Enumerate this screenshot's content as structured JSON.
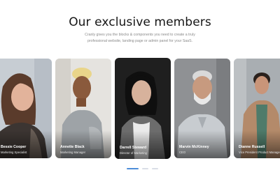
{
  "section": {
    "title": "Our exclusive members",
    "subtitle": "Cranly gives you the blocks & components you need to create a truly professional website, landing page or admin panel for your SaaS."
  },
  "members": [
    {
      "name": "Bessie Cooper",
      "role": "Marketing Specialist"
    },
    {
      "name": "Annette Black",
      "role": "Marketing Manager"
    },
    {
      "name": "Darrell Steward",
      "role": "Director of Marketing"
    },
    {
      "name": "Marvin McKinney",
      "role": "CEO"
    },
    {
      "name": "Dianne Russell",
      "role": "Vice President Product Management"
    }
  ],
  "carousel": {
    "page_count": 3,
    "active_page": 1
  },
  "colors": {
    "accent": "#4d8dd8",
    "inactive_dot": "#d9dde6"
  }
}
